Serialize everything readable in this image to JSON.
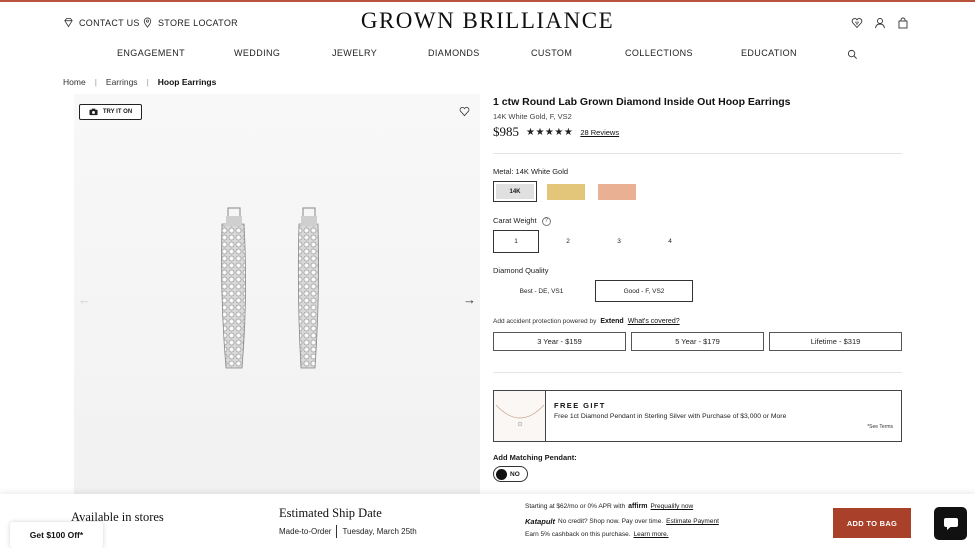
{
  "header": {
    "contact": "CONTACT US",
    "store_locator": "STORE LOCATOR",
    "logo": "GROWN BRILLIANCE",
    "icons": [
      "heart-gem-icon",
      "user-icon",
      "bag-icon"
    ]
  },
  "nav": {
    "items": [
      "ENGAGEMENT",
      "WEDDING",
      "JEWELRY",
      "DIAMONDS",
      "CUSTOM",
      "COLLECTIONS",
      "EDUCATION"
    ],
    "search_icon": "search-icon"
  },
  "breadcrumb": {
    "home": "Home",
    "earrings": "Earrings",
    "current": "Hoop Earrings"
  },
  "gallery": {
    "try_on": "TRY IT ON",
    "prev": "←",
    "next": "→"
  },
  "product": {
    "title": "1 ctw Round Lab Grown Diamond Inside Out Hoop Earrings",
    "subtitle": "14K White Gold, F, VS2",
    "price": "$985",
    "rating_stars": "★★★★★",
    "rating": 4.5,
    "reviews": "28 Reviews"
  },
  "metal": {
    "label_prefix": "Metal:",
    "label_value": "14K White Gold",
    "options": [
      {
        "label": "14K",
        "color": "#e0e0e0"
      },
      {
        "label": "",
        "color": "#e3c679"
      },
      {
        "label": "",
        "color": "#e9b094"
      }
    ]
  },
  "carat": {
    "label": "Carat Weight",
    "help": "?",
    "options": [
      "1",
      "2",
      "3",
      "4"
    ],
    "selected": "1"
  },
  "quality": {
    "label": "Diamond Quality",
    "options": [
      "Best - DE, VS1",
      "Good - F, VS2"
    ],
    "selected": "Good - F, VS2"
  },
  "protection": {
    "text": "Add accident protection powered by",
    "brand": "Extend",
    "link": "What's covered?",
    "plans": [
      "3 Year - $159",
      "5 Year - $179",
      "Lifetime - $319"
    ]
  },
  "gift": {
    "title": "FREE GIFT",
    "description": "Free 1ct Diamond Pendant in Sterling Silver with Purchase of $3,000 or More",
    "terms": "*See Terms"
  },
  "pendant": {
    "label": "Add Matching Pendant:",
    "toggle": "NO"
  },
  "bottom": {
    "stores": "Available in stores",
    "ship_title": "Estimated Ship Date",
    "ship_mode": "Made-to-Order",
    "ship_date": "Tuesday, March 25th",
    "affirm_text": "Starting at $62/mo or 0% APR with",
    "affirm_brand": "affirm",
    "affirm_link": "Prequalify now",
    "katapult_brand": "Katapult",
    "katapult_text": "No credit? Shop now. Pay over time.",
    "katapult_link": "Estimate Payment",
    "cashback_text": "Earn 5% cashback on this purchase.",
    "cashback_link": "Learn more.",
    "add_to_bag": "ADD TO BAG",
    "promo": "Get $100 Off*"
  },
  "colors": {
    "accent": "#a9402a",
    "top_line": "#b9543c"
  }
}
